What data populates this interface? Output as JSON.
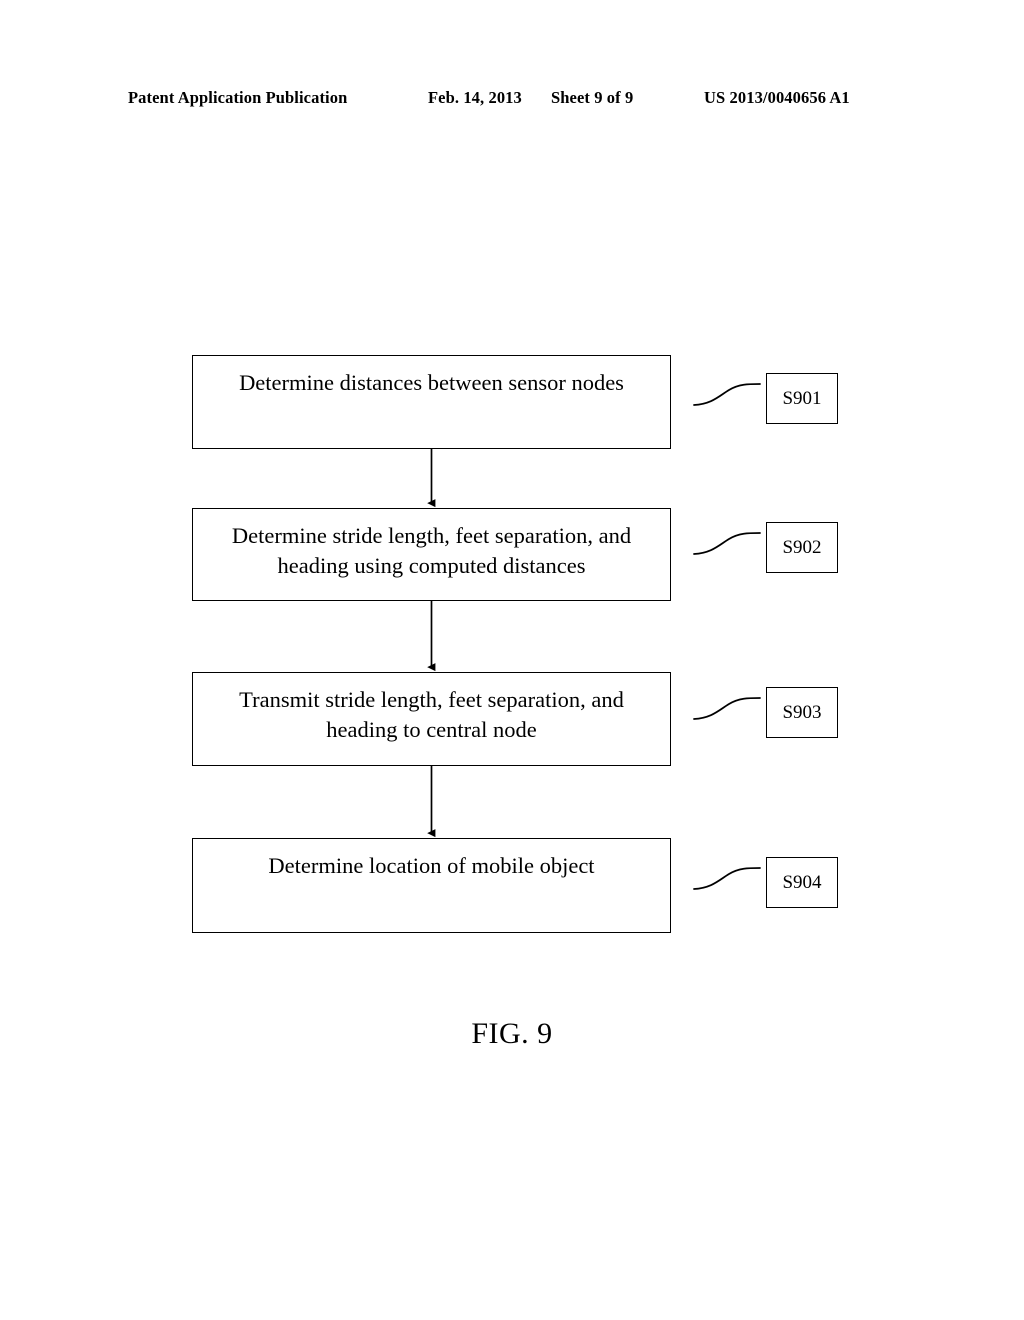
{
  "header": {
    "publication": "Patent Application Publication",
    "date": "Feb. 14, 2013",
    "sheet": "Sheet 9 of 9",
    "document_number": "US 2013/0040656 A1"
  },
  "figure": {
    "caption": "FIG. 9",
    "type": "flowchart",
    "orientation": "vertical",
    "steps": [
      {
        "id": "S901",
        "text": "Determine distances between sensor nodes",
        "ref_label": "S901"
      },
      {
        "id": "S902",
        "text": "Determine stride length, feet separation, and heading using computed distances",
        "ref_label": "S902"
      },
      {
        "id": "S903",
        "text": "Transmit stride length, feet separation, and heading to central node",
        "ref_label": "S903"
      },
      {
        "id": "S904",
        "text": "Determine location of mobile object",
        "ref_label": "S904"
      }
    ],
    "connectors": [
      {
        "from": "S901",
        "to": "S902",
        "style": "arrow-down"
      },
      {
        "from": "S902",
        "to": "S903",
        "style": "arrow-down"
      },
      {
        "from": "S903",
        "to": "S904",
        "style": "arrow-down"
      }
    ],
    "leader_lines": [
      {
        "for": "S901",
        "style": "s-curve"
      },
      {
        "for": "S902",
        "style": "s-curve"
      },
      {
        "for": "S903",
        "style": "s-curve"
      },
      {
        "for": "S904",
        "style": "s-curve"
      }
    ]
  },
  "colors": {
    "ink": "#000000",
    "paper": "#ffffff"
  }
}
